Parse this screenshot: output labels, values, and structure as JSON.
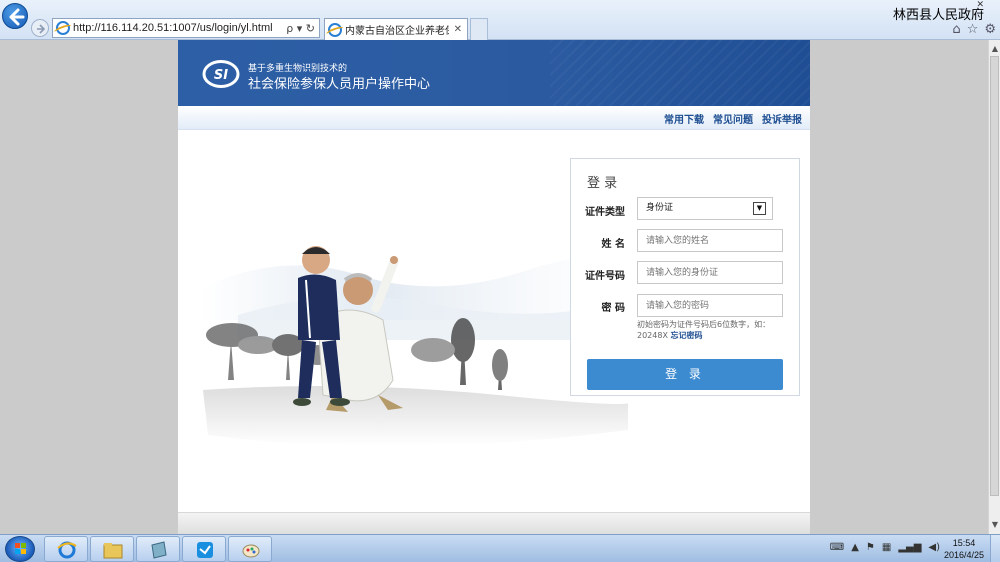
{
  "browser": {
    "url": "http://116.114.20.51:1007/us/login/yl.html",
    "address_tools": "ρ ▾ ↻",
    "tab_title": "内蒙古自治区企业养老保险...",
    "tab_close": "✕",
    "window_title": "林西县人民政府",
    "window_close": "✕",
    "icons": [
      "home-icon",
      "star-icon",
      "gear-icon"
    ]
  },
  "header": {
    "logo_text": "SI",
    "subtitle": "基于多重生物识别技术的",
    "title": "社会保险参保人员用户操作中心"
  },
  "subnav": {
    "links": [
      "常用下载",
      "常见问题",
      "投诉举报"
    ]
  },
  "login": {
    "title": "登 录",
    "id_type_label": "证件类型",
    "id_type_value": "身份证",
    "name_label": "姓 名",
    "name_placeholder": "请输入您的姓名",
    "id_number_label": "证件号码",
    "id_number_placeholder": "请输入您的身份证",
    "password_label": "密 码",
    "password_placeholder": "请输入您的密码",
    "hint_text": "初始密码为证件号码后6位数字，如：20248X",
    "forgot_link": "忘记密码",
    "submit_label": "登 录"
  },
  "taskbar": {
    "items": [
      "ie-icon",
      "folder-icon",
      "notebook-icon",
      "bird-app-icon",
      "paint-icon"
    ],
    "time": "15:54",
    "date": "2016/4/25"
  },
  "colors": {
    "banner": "#2d5fa6",
    "link": "#1f4f92",
    "button": "#3c8ad0"
  }
}
